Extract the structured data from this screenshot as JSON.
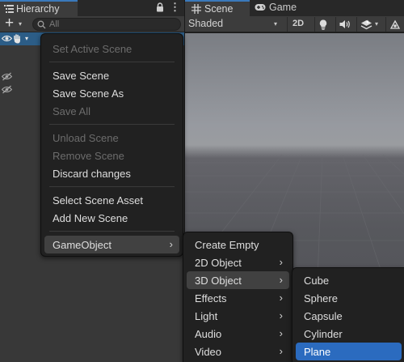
{
  "hierarchy": {
    "tab_label": "Hierarchy",
    "tab_icon": "list-icon",
    "lock_icon": "lock-icon",
    "more_icon": "more-vertical-icon",
    "more_glyph": "⋮",
    "add_glyph": "+",
    "add_caret": "▾",
    "search_placeholder": "All",
    "scene_fold_glyph": "▾"
  },
  "scene_view": {
    "tabs": [
      {
        "label": "Scene",
        "icon": "grid-icon"
      },
      {
        "label": "Game",
        "icon": "gamepad-icon"
      }
    ],
    "shading_mode": "Shaded",
    "dropdown_caret": "▾",
    "mode_2d_label": "2D",
    "toolbar_icons": [
      "lightbulb-icon",
      "speaker-icon",
      "effects-stack-icon",
      "gizmo-icon"
    ]
  },
  "context_menu": {
    "items": [
      {
        "label": "Set Active Scene",
        "enabled": false
      },
      {
        "label": "Save Scene",
        "enabled": true
      },
      {
        "label": "Save Scene As",
        "enabled": true
      },
      {
        "label": "Save All",
        "enabled": false
      },
      {
        "label": "Unload Scene",
        "enabled": false
      },
      {
        "label": "Remove Scene",
        "enabled": false
      },
      {
        "label": "Discard changes",
        "enabled": true
      },
      {
        "label": "Select Scene Asset",
        "enabled": true
      },
      {
        "label": "Add New Scene",
        "enabled": true
      },
      {
        "label": "GameObject",
        "enabled": true,
        "has_submenu": true
      }
    ],
    "submenu_arrow": "›"
  },
  "gameobject_menu": {
    "items": [
      {
        "label": "Create Empty"
      },
      {
        "label": "2D Object",
        "has_submenu": true
      },
      {
        "label": "3D Object",
        "has_submenu": true
      },
      {
        "label": "Effects",
        "has_submenu": true
      },
      {
        "label": "Light",
        "has_submenu": true
      },
      {
        "label": "Audio",
        "has_submenu": true
      },
      {
        "label": "Video",
        "has_submenu": true
      }
    ]
  },
  "object_3d_menu": {
    "items": [
      {
        "label": "Cube"
      },
      {
        "label": "Sphere"
      },
      {
        "label": "Capsule"
      },
      {
        "label": "Cylinder"
      },
      {
        "label": "Plane"
      }
    ],
    "selected": "Plane"
  },
  "colors": {
    "accent_blue": "#2b6bbf",
    "scene_row": "#2c5d87",
    "menu_bg": "#212121",
    "panel_bg": "#383838",
    "disabled_text": "#6c6c6c"
  }
}
